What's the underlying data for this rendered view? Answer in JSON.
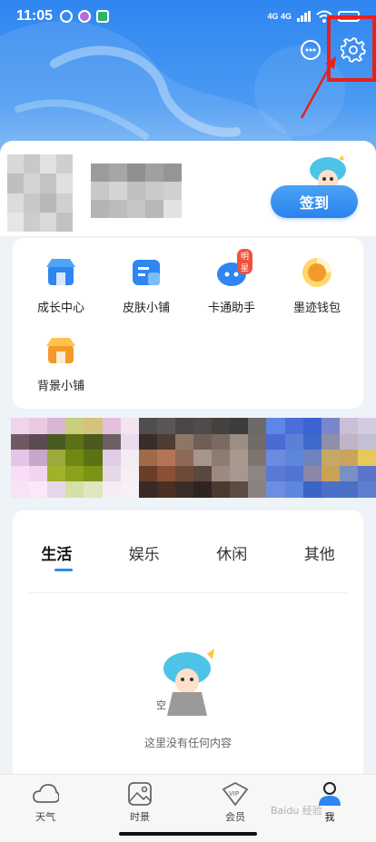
{
  "status_bar": {
    "time": "11:05",
    "network": "4G 4G"
  },
  "header": {
    "message_icon": "message-bubble-icon",
    "settings_icon": "gear-icon"
  },
  "profile": {
    "checkin_label": "签到"
  },
  "tools": [
    {
      "label": "成长中心",
      "icon": "shop-icon"
    },
    {
      "label": "皮肤小铺",
      "icon": "skin-icon"
    },
    {
      "label": "卡通助手",
      "icon": "cartoon-icon",
      "badge": "明星"
    },
    {
      "label": "墨迹钱包",
      "icon": "wallet-icon"
    },
    {
      "label": "背景小铺",
      "icon": "store-icon"
    }
  ],
  "tabs": [
    {
      "label": "生活",
      "active": true
    },
    {
      "label": "娱乐"
    },
    {
      "label": "休闲"
    },
    {
      "label": "其他"
    }
  ],
  "empty_state": {
    "text": "这里没有任何内容"
  },
  "bottom_nav": [
    {
      "label": "天气",
      "icon": "cloud-icon"
    },
    {
      "label": "时景",
      "icon": "image-icon"
    },
    {
      "label": "会员",
      "icon": "vip-icon"
    },
    {
      "label": "我",
      "icon": "user-icon",
      "active": true
    }
  ],
  "watermark": "Baidu 经验",
  "colors": {
    "brand": "#2f86f0",
    "highlight": "#e8201e"
  }
}
